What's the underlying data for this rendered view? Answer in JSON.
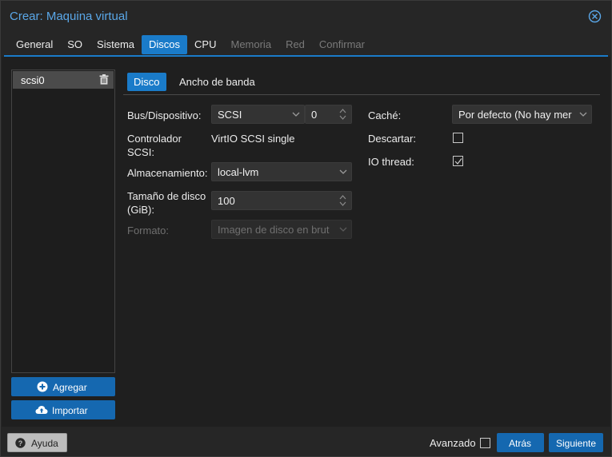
{
  "window": {
    "title": "Crear: Maquina virtual"
  },
  "tabs": [
    {
      "label": "General",
      "state": "normal"
    },
    {
      "label": "SO",
      "state": "normal"
    },
    {
      "label": "Sistema",
      "state": "normal"
    },
    {
      "label": "Discos",
      "state": "active"
    },
    {
      "label": "CPU",
      "state": "normal"
    },
    {
      "label": "Memoria",
      "state": "disabled"
    },
    {
      "label": "Red",
      "state": "disabled"
    },
    {
      "label": "Confirmar",
      "state": "disabled"
    }
  ],
  "disks": {
    "items": [
      {
        "label": "scsi0"
      }
    ],
    "add_label": "Agregar",
    "import_label": "Importar"
  },
  "inner_tabs": [
    {
      "label": "Disco",
      "state": "active"
    },
    {
      "label": "Ancho de banda",
      "state": "normal"
    }
  ],
  "form": {
    "bus_label": "Bus/Dispositivo:",
    "bus_value": "SCSI",
    "device_value": "0",
    "controller_label_1": "Controlador",
    "controller_label_2": "SCSI:",
    "controller_value": "VirtIO SCSI single",
    "storage_label": "Almacenamiento:",
    "storage_value": "local-lvm",
    "size_label_1": "Tamaño de disco",
    "size_label_2": "(GiB):",
    "size_value": "100",
    "format_label": "Formato:",
    "format_value": "Imagen de disco en brut",
    "cache_label": "Caché:",
    "cache_value": "Por defecto (No hay mer",
    "discard_label": "Descartar:",
    "discard_checked": false,
    "iothread_label": "IO thread:",
    "iothread_checked": true
  },
  "footer": {
    "help_label": "Ayuda",
    "advanced_label": "Avanzado",
    "advanced_checked": false,
    "back_label": "Atrás",
    "next_label": "Siguiente"
  },
  "colors": {
    "accent": "#1a7bc9",
    "button_blue": "#1568b0",
    "title": "#5aa7e8",
    "background": "#1f1f1f"
  },
  "icons": [
    "close-icon",
    "trash-icon",
    "plus-circle-icon",
    "cloud-upload-icon",
    "chevron-down-icon",
    "spinner-icon",
    "check-icon",
    "question-circle-icon"
  ]
}
